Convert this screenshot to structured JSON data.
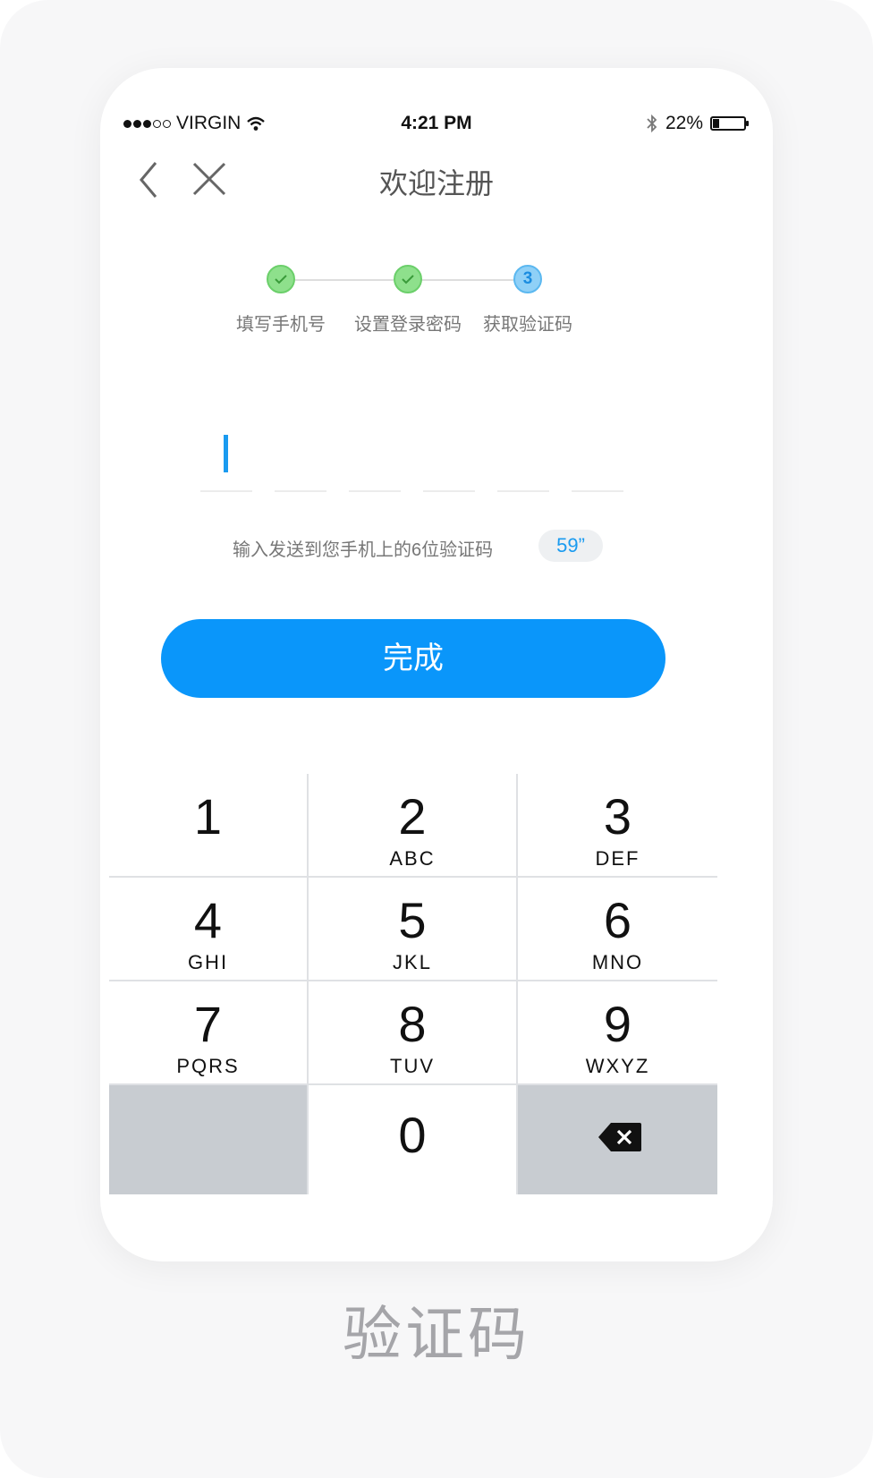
{
  "status_bar": {
    "carrier": "VIRGIN",
    "time": "4:21 PM",
    "battery": "22%",
    "battery_level": 0.22
  },
  "nav": {
    "title": "欢迎注册"
  },
  "steps": [
    {
      "label": "填写手机号",
      "state": "done"
    },
    {
      "label": "设置登录密码",
      "state": "done"
    },
    {
      "label": "获取验证码",
      "state": "active",
      "number": "3"
    }
  ],
  "code_input": {
    "length": 6,
    "value": ""
  },
  "hint": "输入发送到您手机上的6位验证码",
  "timer": "59”",
  "done_button": "完成",
  "keypad": {
    "keys": [
      {
        "num": "1",
        "letters": ""
      },
      {
        "num": "2",
        "letters": "ABC"
      },
      {
        "num": "3",
        "letters": "DEF"
      },
      {
        "num": "4",
        "letters": "GHI"
      },
      {
        "num": "5",
        "letters": "JKL"
      },
      {
        "num": "6",
        "letters": "MNO"
      },
      {
        "num": "7",
        "letters": "PQRS"
      },
      {
        "num": "8",
        "letters": "TUV"
      },
      {
        "num": "9",
        "letters": "WXYZ"
      },
      {
        "num": "0",
        "letters": ""
      }
    ],
    "delete_icon": "backspace-icon"
  },
  "caption": "验证码",
  "colors": {
    "accent": "#0a96fa",
    "step_done": "#8ee08c",
    "step_active": "#8fd0f7"
  }
}
